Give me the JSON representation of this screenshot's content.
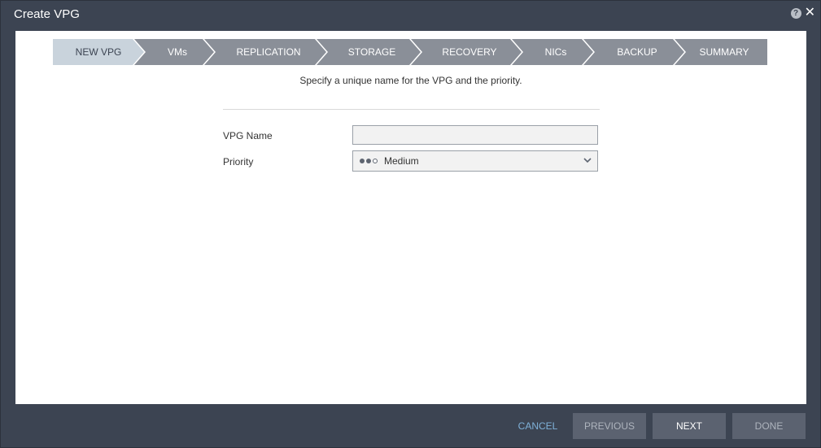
{
  "window": {
    "title": "Create VPG",
    "help_icon": "help-icon",
    "close_icon": "close-icon"
  },
  "wizard": {
    "steps": [
      {
        "label": "NEW VPG",
        "active": true
      },
      {
        "label": "VMs",
        "active": false
      },
      {
        "label": "REPLICATION",
        "active": false
      },
      {
        "label": "STORAGE",
        "active": false
      },
      {
        "label": "RECOVERY",
        "active": false
      },
      {
        "label": "NICs",
        "active": false
      },
      {
        "label": "BACKUP",
        "active": false
      },
      {
        "label": "SUMMARY",
        "active": false
      }
    ]
  },
  "form": {
    "subtitle": "Specify a unique name for the VPG and the priority.",
    "vpg_name_label": "VPG Name",
    "vpg_name_value": "",
    "priority_label": "Priority",
    "priority_value": "Medium",
    "priority_level": 2,
    "priority_max": 3
  },
  "footer": {
    "cancel": "CANCEL",
    "previous": "PREVIOUS",
    "next": "NEXT",
    "done": "DONE"
  },
  "colors": {
    "active_step": "#c9d3dc",
    "inactive_step": "#8a8f98",
    "cancel_link": "#7fb1d9",
    "dialog_bg": "#3c4452"
  }
}
